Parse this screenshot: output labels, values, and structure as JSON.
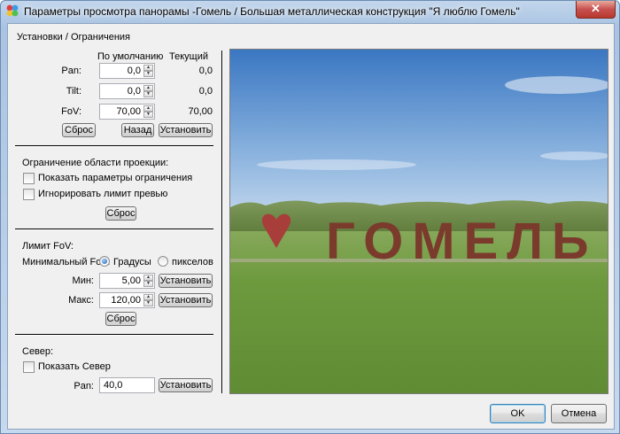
{
  "window": {
    "title": "Параметры просмотра панорамы -Гомель / Большая металлическая конструкция \"Я люблю Гомель\"",
    "close_label": "✕"
  },
  "limits_group": {
    "title": "Установки / Ограничения",
    "header_default": "По умолчанию",
    "header_current": "Текущий",
    "rows": [
      {
        "label": "Pan:",
        "default": "0,0",
        "current": "0,0"
      },
      {
        "label": "Tilt:",
        "default": "0,0",
        "current": "0,0"
      },
      {
        "label": "FoV:",
        "default": "70,00",
        "current": "70,00"
      }
    ],
    "reset_label": "Сброс",
    "back_label": "Назад",
    "set_label": "Установить"
  },
  "projection": {
    "title": "Ограничение области проекции:",
    "show_limits_label": "Показать параметры ограничения",
    "ignore_limit_label": "Игнорировать лимит превью",
    "reset_label": "Сброс"
  },
  "fov_limit": {
    "title": "Лимит FoV:",
    "min_fov_label": "Минимальный FoV:",
    "radio_degrees": "Градусы",
    "radio_pixels": "пикселов",
    "min_label": "Мин:",
    "min_value": "5,00",
    "max_label": "Макс:",
    "max_value": "120,00",
    "set_label": "Установить",
    "reset_label": "Сброс"
  },
  "north": {
    "title": "Север:",
    "show_north_label": "Показать Север",
    "pan_label": "Pan:",
    "pan_value": "40,0",
    "set_label": "Установить"
  },
  "footer": {
    "ok_label": "OK",
    "cancel_label": "Отмена"
  },
  "preview": {
    "sculpture_text": "ГОМЕЛЬ"
  },
  "colors": {
    "sky_top": "#3f7fc9",
    "sky_bottom": "#bcd3ea",
    "grass": "#6f9a3e",
    "letters": "#7a3a2c",
    "heart": "#b23a3a"
  }
}
